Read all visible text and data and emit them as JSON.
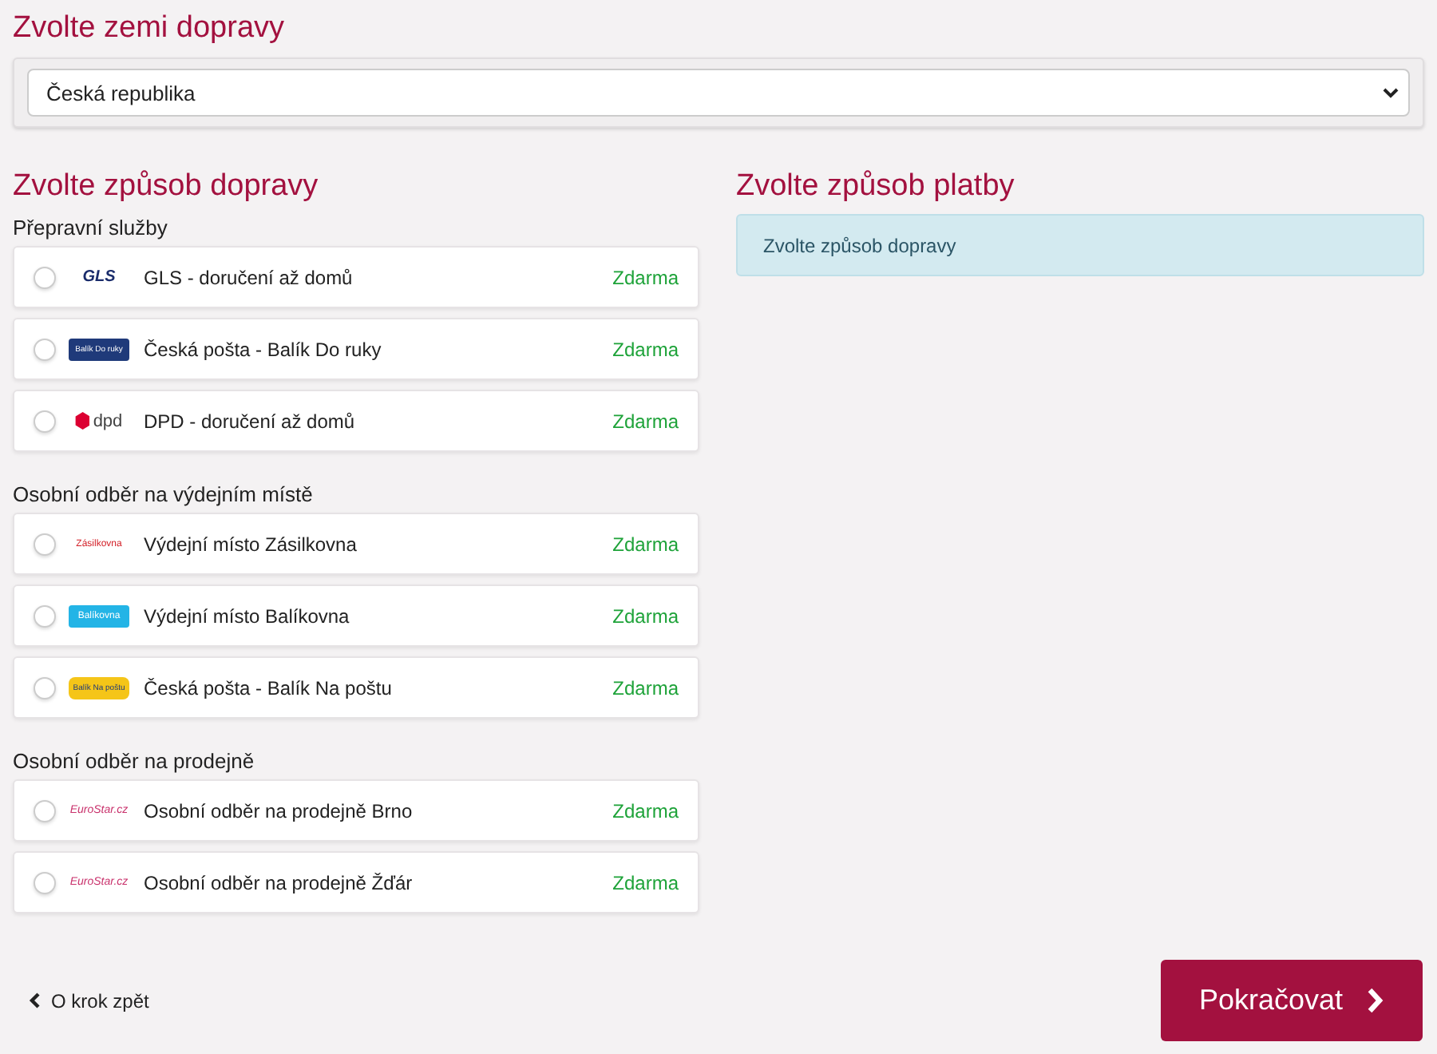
{
  "country": {
    "heading": "Zvolte zemi dopravy",
    "value": "Česká republika"
  },
  "shipping": {
    "heading": "Zvolte způsob dopravy",
    "groups": [
      {
        "title": "Přepravní služby",
        "options": [
          {
            "kind": "gls",
            "logo_text": "GLS",
            "label": "GLS - doručení až domů",
            "price": "Zdarma",
            "selected": false
          },
          {
            "kind": "posta-blue",
            "logo_text": "Balík Do ruky",
            "label": "Česká pošta - Balík Do ruky",
            "price": "Zdarma",
            "selected": false
          },
          {
            "kind": "dpd",
            "logo_text": "dpd",
            "label": "DPD - doručení až domů",
            "price": "Zdarma",
            "selected": false
          }
        ]
      },
      {
        "title": "Osobní odběr na výdejním místě",
        "options": [
          {
            "kind": "zasilkovna",
            "logo_text": "Zásilkovna",
            "label": "Výdejní místo Zásilkovna",
            "price": "Zdarma",
            "selected": false
          },
          {
            "kind": "balikovna",
            "logo_text": "Balíkovna",
            "label": "Výdejní místo Balíkovna",
            "price": "Zdarma",
            "selected": false
          },
          {
            "kind": "posta-yellow",
            "logo_text": "Balík Na poštu",
            "label": "Česká pošta - Balík Na poštu",
            "price": "Zdarma",
            "selected": false
          }
        ]
      },
      {
        "title": "Osobní odběr na prodejně",
        "options": [
          {
            "kind": "eurostar",
            "logo_text": "EuroStar.cz",
            "label": "Osobní odběr na prodejně Brno",
            "price": "Zdarma",
            "selected": false
          },
          {
            "kind": "eurostar",
            "logo_text": "EuroStar.cz",
            "label": "Osobní odběr na prodejně Žďár",
            "price": "Zdarma",
            "selected": false
          }
        ]
      }
    ]
  },
  "payment": {
    "heading": "Zvolte způsob platby",
    "notice": "Zvolte způsob dopravy"
  },
  "back_link": "O krok zpět",
  "continue_button": "Pokračovat"
}
